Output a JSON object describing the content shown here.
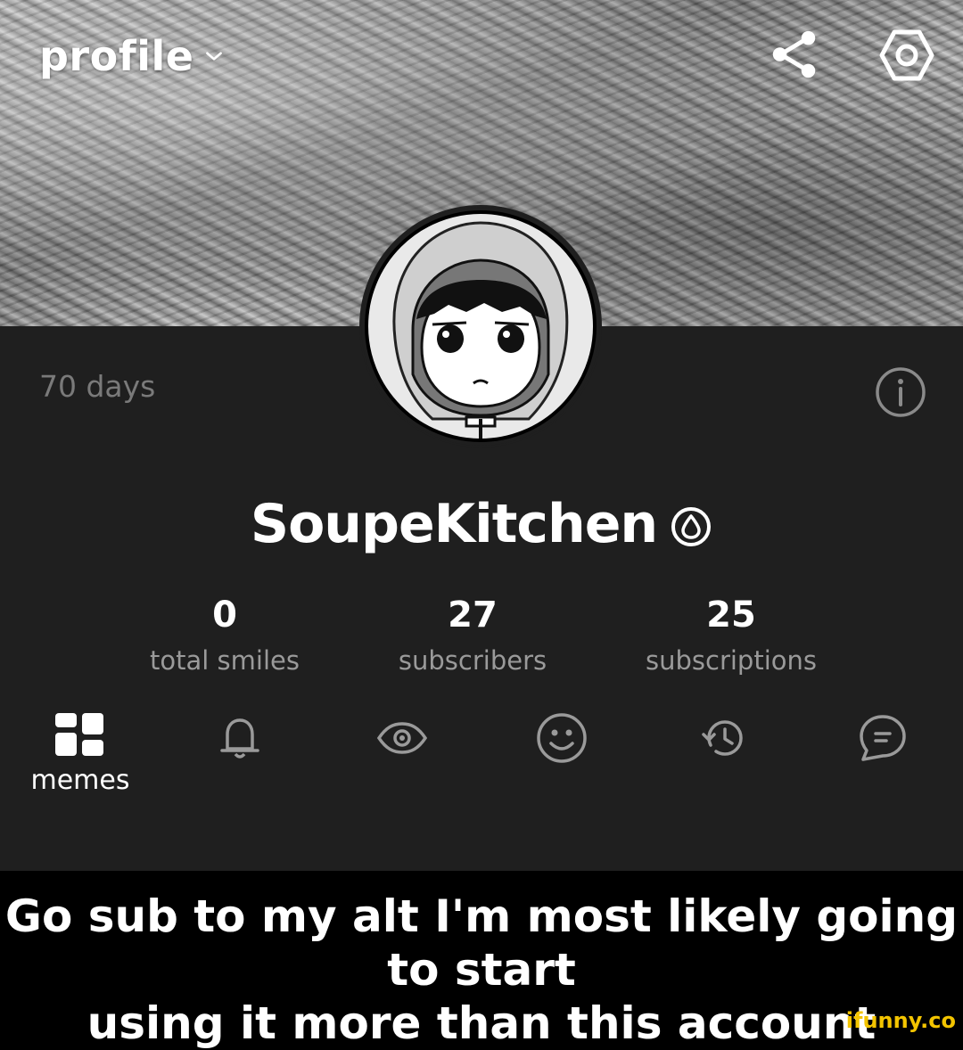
{
  "header": {
    "title": "profile",
    "title_chevron_icon": "chevron-down-icon",
    "share_icon": "share-icon",
    "settings_icon": "settings-hex-icon"
  },
  "profile": {
    "days": "70 days",
    "info_icon": "info-icon",
    "username": "SoupeKitchen",
    "badge_icon": "drop-icon"
  },
  "stats": [
    {
      "value": "0",
      "label": "total smiles"
    },
    {
      "value": "27",
      "label": "subscribers"
    },
    {
      "value": "25",
      "label": "subscriptions"
    }
  ],
  "tabs": [
    {
      "icon": "grid-icon",
      "label": "memes",
      "selected": true
    },
    {
      "icon": "bell-icon",
      "selected": false
    },
    {
      "icon": "eye-icon",
      "selected": false
    },
    {
      "icon": "smile-icon",
      "selected": false
    },
    {
      "icon": "history-icon",
      "selected": false
    },
    {
      "icon": "chat-icon",
      "selected": false
    }
  ],
  "caption": {
    "line1": "Go sub to my alt I'm most likely going to start",
    "line2": "using it more than this account"
  },
  "watermark": "ifunny.co",
  "colors": {
    "app_background": "#1f1f1f",
    "caption_background": "#000000",
    "muted_text": "#9a9a9a",
    "watermark": "#f3c400"
  }
}
